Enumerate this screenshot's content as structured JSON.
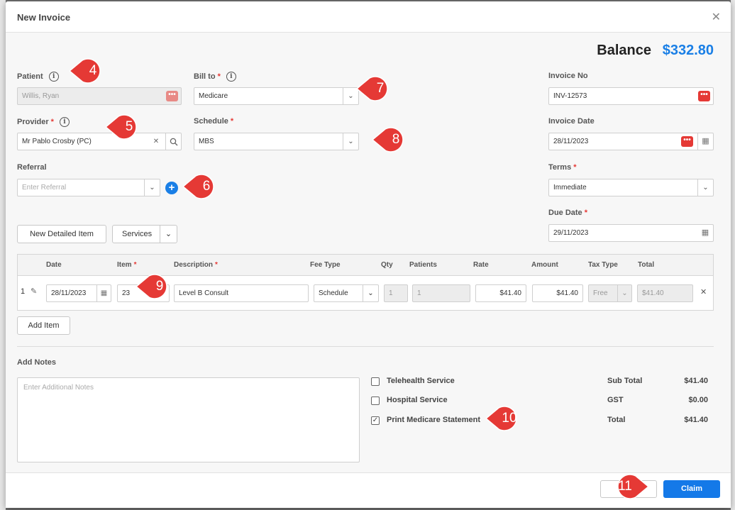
{
  "modal": {
    "title": "New Invoice",
    "close_glyph": "✕"
  },
  "balance": {
    "label": "Balance",
    "value": "$332.80"
  },
  "patient": {
    "label": "Patient",
    "value": "Willis, Ryan"
  },
  "bill_to": {
    "label": "Bill to",
    "value": "Medicare"
  },
  "invoice_no": {
    "label": "Invoice No",
    "value": "INV-12573"
  },
  "provider": {
    "label": "Provider",
    "value": "Mr Pablo Crosby (PC)"
  },
  "schedule": {
    "label": "Schedule",
    "value": "MBS"
  },
  "invoice_date": {
    "label": "Invoice Date",
    "value": "28/11/2023"
  },
  "referral": {
    "label": "Referral",
    "placeholder": "Enter Referral"
  },
  "terms": {
    "label": "Terms",
    "value": "Immediate"
  },
  "due_date": {
    "label": "Due Date",
    "value": "29/11/2023"
  },
  "toolbar": {
    "new_detailed_item": "New Detailed Item",
    "services": "Services",
    "add_item": "Add Item"
  },
  "table": {
    "headers": [
      "Date",
      "Item",
      "Description",
      "Fee Type",
      "Qty",
      "Patients",
      "Rate",
      "Amount",
      "Tax Type",
      "Total"
    ],
    "rows": [
      {
        "num": "1",
        "date": "28/11/2023",
        "item": "23",
        "description": "Level B Consult",
        "fee_type": "Schedule",
        "qty": "1",
        "patients": "1",
        "rate": "$41.40",
        "amount": "$41.40",
        "tax_type": "Free",
        "total": "$41.40"
      }
    ]
  },
  "notes": {
    "label": "Add Notes",
    "placeholder": "Enter Additional Notes"
  },
  "options": [
    {
      "label": "Telehealth Service",
      "checked": false
    },
    {
      "label": "Hospital Service",
      "checked": false
    },
    {
      "label": "Print Medicare Statement",
      "checked": true
    }
  ],
  "summary": [
    {
      "label": "Sub Total",
      "value": "$41.40"
    },
    {
      "label": "GST",
      "value": "$0.00"
    },
    {
      "label": "Total",
      "value": "$41.40"
    }
  ],
  "footer": {
    "claim": "Claim"
  },
  "callouts": [
    "4",
    "5",
    "6",
    "7",
    "8",
    "9",
    "10",
    "11"
  ],
  "colors": {
    "accent": "#1479e8",
    "callout": "#e53935",
    "required": "#e53935"
  }
}
